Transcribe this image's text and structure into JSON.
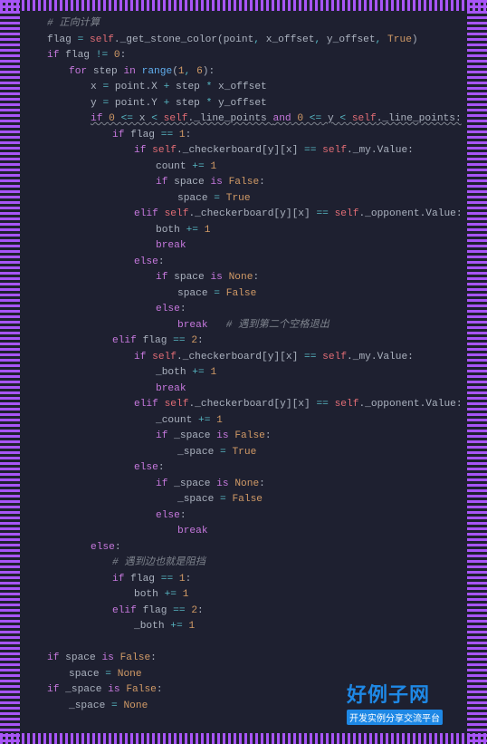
{
  "watermark": {
    "title": "好例子网",
    "subtitle": "开发实例分享交流平台"
  },
  "code": [
    {
      "i": 1,
      "t": [
        {
          "c": "cmt",
          "v": "# 正向计算"
        }
      ]
    },
    {
      "i": 1,
      "t": [
        {
          "c": "txt",
          "v": "flag "
        },
        {
          "c": "op",
          "v": "="
        },
        {
          "c": "txt",
          "v": " "
        },
        {
          "c": "self",
          "v": "self"
        },
        {
          "c": "txt",
          "v": "._get_stone_color(point"
        },
        {
          "c": "op",
          "v": ","
        },
        {
          "c": "txt",
          "v": " x_offset"
        },
        {
          "c": "op",
          "v": ","
        },
        {
          "c": "txt",
          "v": " y_offset"
        },
        {
          "c": "op",
          "v": ","
        },
        {
          "c": "txt",
          "v": " "
        },
        {
          "c": "bool",
          "v": "True"
        },
        {
          "c": "txt",
          "v": ")"
        }
      ]
    },
    {
      "i": 1,
      "t": [
        {
          "c": "kw",
          "v": "if"
        },
        {
          "c": "txt",
          "v": " flag "
        },
        {
          "c": "op",
          "v": "!="
        },
        {
          "c": "txt",
          "v": " "
        },
        {
          "c": "num",
          "v": "0"
        },
        {
          "c": "txt",
          "v": ":"
        }
      ]
    },
    {
      "i": 2,
      "t": [
        {
          "c": "kw",
          "v": "for"
        },
        {
          "c": "txt",
          "v": " step "
        },
        {
          "c": "kw",
          "v": "in"
        },
        {
          "c": "txt",
          "v": " "
        },
        {
          "c": "fn",
          "v": "range"
        },
        {
          "c": "txt",
          "v": "("
        },
        {
          "c": "num",
          "v": "1"
        },
        {
          "c": "op",
          "v": ","
        },
        {
          "c": "txt",
          "v": " "
        },
        {
          "c": "num",
          "v": "6"
        },
        {
          "c": "txt",
          "v": "):"
        }
      ]
    },
    {
      "i": 3,
      "t": [
        {
          "c": "txt",
          "v": "x "
        },
        {
          "c": "op",
          "v": "="
        },
        {
          "c": "txt",
          "v": " point.X "
        },
        {
          "c": "op",
          "v": "+"
        },
        {
          "c": "txt",
          "v": " step "
        },
        {
          "c": "op",
          "v": "*"
        },
        {
          "c": "txt",
          "v": " x_offset"
        }
      ]
    },
    {
      "i": 3,
      "t": [
        {
          "c": "txt",
          "v": "y "
        },
        {
          "c": "op",
          "v": "="
        },
        {
          "c": "txt",
          "v": " point.Y "
        },
        {
          "c": "op",
          "v": "+"
        },
        {
          "c": "txt",
          "v": " step "
        },
        {
          "c": "op",
          "v": "*"
        },
        {
          "c": "txt",
          "v": " y_offset"
        }
      ]
    },
    {
      "i": 3,
      "wavy": true,
      "t": [
        {
          "c": "kw",
          "v": "if"
        },
        {
          "c": "txt",
          "v": " "
        },
        {
          "c": "num",
          "v": "0"
        },
        {
          "c": "txt",
          "v": " "
        },
        {
          "c": "op",
          "v": "<="
        },
        {
          "c": "txt",
          "v": " x "
        },
        {
          "c": "op",
          "v": "<"
        },
        {
          "c": "txt",
          "v": " "
        },
        {
          "c": "self",
          "v": "self"
        },
        {
          "c": "txt",
          "v": "._line_points "
        },
        {
          "c": "kw",
          "v": "and"
        },
        {
          "c": "txt",
          "v": " "
        },
        {
          "c": "num",
          "v": "0"
        },
        {
          "c": "txt",
          "v": " "
        },
        {
          "c": "op",
          "v": "<="
        },
        {
          "c": "txt",
          "v": " y "
        },
        {
          "c": "op",
          "v": "<"
        },
        {
          "c": "txt",
          "v": " "
        },
        {
          "c": "self",
          "v": "self"
        },
        {
          "c": "txt",
          "v": "._line_points:"
        }
      ]
    },
    {
      "i": 4,
      "t": [
        {
          "c": "kw",
          "v": "if"
        },
        {
          "c": "txt",
          "v": " flag "
        },
        {
          "c": "op",
          "v": "=="
        },
        {
          "c": "txt",
          "v": " "
        },
        {
          "c": "num",
          "v": "1"
        },
        {
          "c": "txt",
          "v": ":"
        }
      ]
    },
    {
      "i": 5,
      "t": [
        {
          "c": "kw",
          "v": "if"
        },
        {
          "c": "txt",
          "v": " "
        },
        {
          "c": "self",
          "v": "self"
        },
        {
          "c": "txt",
          "v": "._checkerboard[y][x] "
        },
        {
          "c": "op",
          "v": "=="
        },
        {
          "c": "txt",
          "v": " "
        },
        {
          "c": "self",
          "v": "self"
        },
        {
          "c": "txt",
          "v": "._my.Value:"
        }
      ]
    },
    {
      "i": 6,
      "t": [
        {
          "c": "txt",
          "v": "count "
        },
        {
          "c": "op",
          "v": "+="
        },
        {
          "c": "txt",
          "v": " "
        },
        {
          "c": "num",
          "v": "1"
        }
      ]
    },
    {
      "i": 6,
      "t": [
        {
          "c": "kw",
          "v": "if"
        },
        {
          "c": "txt",
          "v": " space "
        },
        {
          "c": "kw",
          "v": "is"
        },
        {
          "c": "txt",
          "v": " "
        },
        {
          "c": "bool",
          "v": "False"
        },
        {
          "c": "txt",
          "v": ":"
        }
      ]
    },
    {
      "i": 7,
      "t": [
        {
          "c": "txt",
          "v": "space "
        },
        {
          "c": "op",
          "v": "="
        },
        {
          "c": "txt",
          "v": " "
        },
        {
          "c": "bool",
          "v": "True"
        }
      ]
    },
    {
      "i": 5,
      "t": [
        {
          "c": "kw",
          "v": "elif"
        },
        {
          "c": "txt",
          "v": " "
        },
        {
          "c": "self",
          "v": "self"
        },
        {
          "c": "txt",
          "v": "._checkerboard[y][x] "
        },
        {
          "c": "op",
          "v": "=="
        },
        {
          "c": "txt",
          "v": " "
        },
        {
          "c": "self",
          "v": "self"
        },
        {
          "c": "txt",
          "v": "._opponent.Value:"
        }
      ]
    },
    {
      "i": 6,
      "t": [
        {
          "c": "txt",
          "v": "both "
        },
        {
          "c": "op",
          "v": "+="
        },
        {
          "c": "txt",
          "v": " "
        },
        {
          "c": "num",
          "v": "1"
        }
      ]
    },
    {
      "i": 6,
      "t": [
        {
          "c": "kw",
          "v": "break"
        }
      ]
    },
    {
      "i": 5,
      "t": [
        {
          "c": "kw",
          "v": "else"
        },
        {
          "c": "txt",
          "v": ":"
        }
      ]
    },
    {
      "i": 6,
      "t": [
        {
          "c": "kw",
          "v": "if"
        },
        {
          "c": "txt",
          "v": " space "
        },
        {
          "c": "kw",
          "v": "is"
        },
        {
          "c": "txt",
          "v": " "
        },
        {
          "c": "bool",
          "v": "None"
        },
        {
          "c": "txt",
          "v": ":"
        }
      ]
    },
    {
      "i": 7,
      "t": [
        {
          "c": "txt",
          "v": "space "
        },
        {
          "c": "op",
          "v": "="
        },
        {
          "c": "txt",
          "v": " "
        },
        {
          "c": "bool",
          "v": "False"
        }
      ]
    },
    {
      "i": 6,
      "t": [
        {
          "c": "kw",
          "v": "else"
        },
        {
          "c": "txt",
          "v": ":"
        }
      ]
    },
    {
      "i": 7,
      "t": [
        {
          "c": "kw",
          "v": "break"
        },
        {
          "c": "txt",
          "v": "   "
        },
        {
          "c": "cmt",
          "v": "# 遇到第二个空格退出"
        }
      ]
    },
    {
      "i": 4,
      "t": [
        {
          "c": "kw",
          "v": "elif"
        },
        {
          "c": "txt",
          "v": " flag "
        },
        {
          "c": "op",
          "v": "=="
        },
        {
          "c": "txt",
          "v": " "
        },
        {
          "c": "num",
          "v": "2"
        },
        {
          "c": "txt",
          "v": ":"
        }
      ]
    },
    {
      "i": 5,
      "t": [
        {
          "c": "kw",
          "v": "if"
        },
        {
          "c": "txt",
          "v": " "
        },
        {
          "c": "self",
          "v": "self"
        },
        {
          "c": "txt",
          "v": "._checkerboard[y][x] "
        },
        {
          "c": "op",
          "v": "=="
        },
        {
          "c": "txt",
          "v": " "
        },
        {
          "c": "self",
          "v": "self"
        },
        {
          "c": "txt",
          "v": "._my.Value:"
        }
      ]
    },
    {
      "i": 6,
      "t": [
        {
          "c": "txt",
          "v": "_both "
        },
        {
          "c": "op",
          "v": "+="
        },
        {
          "c": "txt",
          "v": " "
        },
        {
          "c": "num",
          "v": "1"
        }
      ]
    },
    {
      "i": 6,
      "t": [
        {
          "c": "kw",
          "v": "break"
        }
      ]
    },
    {
      "i": 5,
      "t": [
        {
          "c": "kw",
          "v": "elif"
        },
        {
          "c": "txt",
          "v": " "
        },
        {
          "c": "self",
          "v": "self"
        },
        {
          "c": "txt",
          "v": "._checkerboard[y][x] "
        },
        {
          "c": "op",
          "v": "=="
        },
        {
          "c": "txt",
          "v": " "
        },
        {
          "c": "self",
          "v": "self"
        },
        {
          "c": "txt",
          "v": "._opponent.Value:"
        }
      ]
    },
    {
      "i": 6,
      "t": [
        {
          "c": "txt",
          "v": "_count "
        },
        {
          "c": "op",
          "v": "+="
        },
        {
          "c": "txt",
          "v": " "
        },
        {
          "c": "num",
          "v": "1"
        }
      ]
    },
    {
      "i": 6,
      "t": [
        {
          "c": "kw",
          "v": "if"
        },
        {
          "c": "txt",
          "v": " _space "
        },
        {
          "c": "kw",
          "v": "is"
        },
        {
          "c": "txt",
          "v": " "
        },
        {
          "c": "bool",
          "v": "False"
        },
        {
          "c": "txt",
          "v": ":"
        }
      ]
    },
    {
      "i": 7,
      "t": [
        {
          "c": "txt",
          "v": "_space "
        },
        {
          "c": "op",
          "v": "="
        },
        {
          "c": "txt",
          "v": " "
        },
        {
          "c": "bool",
          "v": "True"
        }
      ]
    },
    {
      "i": 5,
      "t": [
        {
          "c": "kw",
          "v": "else"
        },
        {
          "c": "txt",
          "v": ":"
        }
      ]
    },
    {
      "i": 6,
      "t": [
        {
          "c": "kw",
          "v": "if"
        },
        {
          "c": "txt",
          "v": " _space "
        },
        {
          "c": "kw",
          "v": "is"
        },
        {
          "c": "txt",
          "v": " "
        },
        {
          "c": "bool",
          "v": "None"
        },
        {
          "c": "txt",
          "v": ":"
        }
      ]
    },
    {
      "i": 7,
      "t": [
        {
          "c": "txt",
          "v": "_space "
        },
        {
          "c": "op",
          "v": "="
        },
        {
          "c": "txt",
          "v": " "
        },
        {
          "c": "bool",
          "v": "False"
        }
      ]
    },
    {
      "i": 6,
      "t": [
        {
          "c": "kw",
          "v": "else"
        },
        {
          "c": "txt",
          "v": ":"
        }
      ]
    },
    {
      "i": 7,
      "t": [
        {
          "c": "kw",
          "v": "break"
        }
      ]
    },
    {
      "i": 3,
      "t": [
        {
          "c": "kw",
          "v": "else"
        },
        {
          "c": "txt",
          "v": ":"
        }
      ]
    },
    {
      "i": 4,
      "t": [
        {
          "c": "cmt",
          "v": "# 遇到边也就是阻挡"
        }
      ]
    },
    {
      "i": 4,
      "t": [
        {
          "c": "kw",
          "v": "if"
        },
        {
          "c": "txt",
          "v": " flag "
        },
        {
          "c": "op",
          "v": "=="
        },
        {
          "c": "txt",
          "v": " "
        },
        {
          "c": "num",
          "v": "1"
        },
        {
          "c": "txt",
          "v": ":"
        }
      ]
    },
    {
      "i": 5,
      "t": [
        {
          "c": "txt",
          "v": "both "
        },
        {
          "c": "op",
          "v": "+="
        },
        {
          "c": "txt",
          "v": " "
        },
        {
          "c": "num",
          "v": "1"
        }
      ]
    },
    {
      "i": 4,
      "t": [
        {
          "c": "kw",
          "v": "elif"
        },
        {
          "c": "txt",
          "v": " flag "
        },
        {
          "c": "op",
          "v": "=="
        },
        {
          "c": "txt",
          "v": " "
        },
        {
          "c": "num",
          "v": "2"
        },
        {
          "c": "txt",
          "v": ":"
        }
      ]
    },
    {
      "i": 5,
      "t": [
        {
          "c": "txt",
          "v": "_both "
        },
        {
          "c": "op",
          "v": "+="
        },
        {
          "c": "txt",
          "v": " "
        },
        {
          "c": "num",
          "v": "1"
        }
      ]
    },
    {
      "i": 0,
      "t": []
    },
    {
      "i": 1,
      "t": [
        {
          "c": "kw",
          "v": "if"
        },
        {
          "c": "txt",
          "v": " space "
        },
        {
          "c": "kw",
          "v": "is"
        },
        {
          "c": "txt",
          "v": " "
        },
        {
          "c": "bool",
          "v": "False"
        },
        {
          "c": "txt",
          "v": ":"
        }
      ]
    },
    {
      "i": 2,
      "t": [
        {
          "c": "txt",
          "v": "space "
        },
        {
          "c": "op",
          "v": "="
        },
        {
          "c": "txt",
          "v": " "
        },
        {
          "c": "bool",
          "v": "None"
        }
      ]
    },
    {
      "i": 1,
      "t": [
        {
          "c": "kw",
          "v": "if"
        },
        {
          "c": "txt",
          "v": " _space "
        },
        {
          "c": "kw",
          "v": "is"
        },
        {
          "c": "txt",
          "v": " "
        },
        {
          "c": "bool",
          "v": "False"
        },
        {
          "c": "txt",
          "v": ":"
        }
      ]
    },
    {
      "i": 2,
      "t": [
        {
          "c": "txt",
          "v": "_space "
        },
        {
          "c": "op",
          "v": "="
        },
        {
          "c": "txt",
          "v": " "
        },
        {
          "c": "bool",
          "v": "None"
        }
      ]
    }
  ]
}
